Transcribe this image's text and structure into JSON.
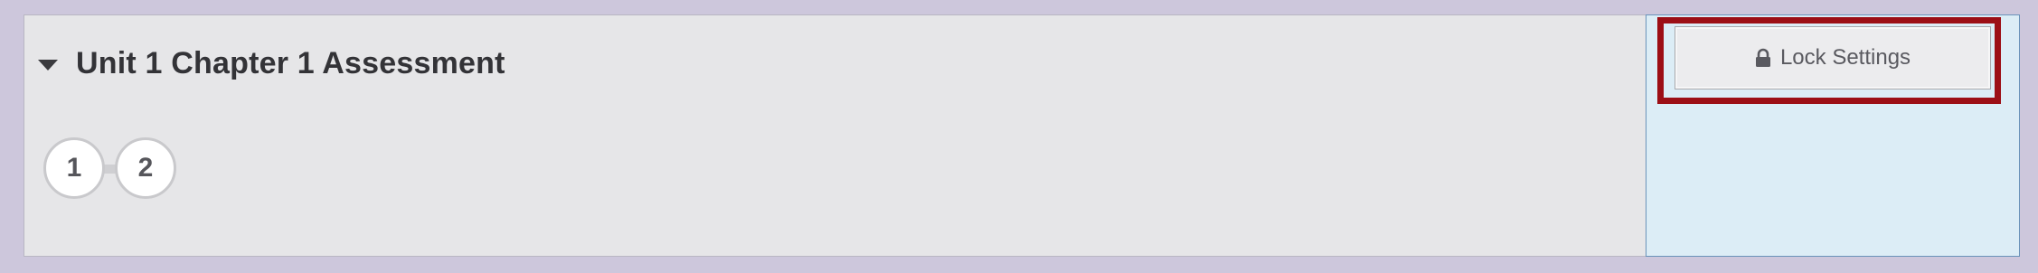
{
  "assessment": {
    "title": "Unit 1 Chapter 1 Assessment",
    "expanded": true,
    "steps": [
      {
        "label": "1"
      },
      {
        "label": "2"
      }
    ]
  },
  "sidebar": {
    "lock_button_label": "Lock Settings",
    "lock_icon": "lock-icon",
    "highlight_color": "#9c0f16",
    "background_color": "#dcedf6"
  },
  "colors": {
    "page_background": "#cdc7dc",
    "panel_background": "#e6e6e8"
  }
}
